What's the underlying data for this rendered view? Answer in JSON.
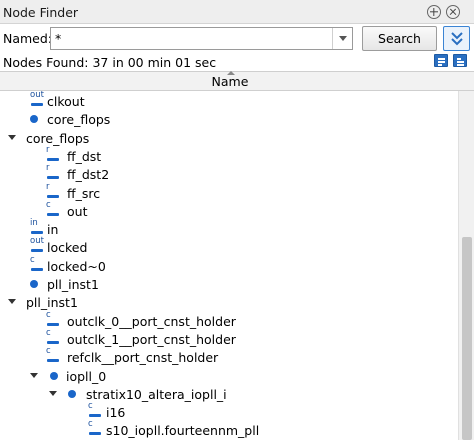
{
  "window": {
    "title": "Node Finder"
  },
  "filter": {
    "named_label": "Named:",
    "named_value": "*",
    "search_label": "Search"
  },
  "status": {
    "nodes_found": "Nodes Found: 37 in 00 min 01 sec"
  },
  "table": {
    "column_name": "Name"
  },
  "icons": {
    "add": "add-icon",
    "close": "close-icon",
    "collapse": "double-chevron-down-icon",
    "expand_all": "expand-all-icon",
    "collapse_all": "collapse-all-icon"
  },
  "colors": {
    "node_dot": "#1a66c9",
    "accent": "#3b84d4"
  },
  "tree": [
    {
      "label": "clkout",
      "kind": "port",
      "tag": "out",
      "depth": 0
    },
    {
      "label": "core_flops",
      "kind": "dot",
      "depth": 0
    },
    {
      "label": "core_flops",
      "kind": "expanded",
      "depth": -1
    },
    {
      "label": "ff_dst",
      "kind": "port",
      "tag": "r",
      "depth": 1
    },
    {
      "label": "ff_dst2",
      "kind": "port",
      "tag": "r",
      "depth": 1
    },
    {
      "label": "ff_src",
      "kind": "port",
      "tag": "r",
      "depth": 1
    },
    {
      "label": "out",
      "kind": "port",
      "tag": "c",
      "depth": 1
    },
    {
      "label": "in",
      "kind": "port",
      "tag": "in",
      "depth": 0
    },
    {
      "label": "locked",
      "kind": "port",
      "tag": "out",
      "depth": 0
    },
    {
      "label": "locked~0",
      "kind": "port",
      "tag": "c",
      "depth": 0
    },
    {
      "label": "pll_inst1",
      "kind": "dot",
      "depth": 0
    },
    {
      "label": "pll_inst1",
      "kind": "expanded",
      "depth": -1
    },
    {
      "label": "outclk_0__port_cnst_holder",
      "kind": "port",
      "tag": "c",
      "depth": 1
    },
    {
      "label": "outclk_1__port_cnst_holder",
      "kind": "port",
      "tag": "c",
      "depth": 1
    },
    {
      "label": "refclk__port_cnst_holder",
      "kind": "port",
      "tag": "c",
      "depth": 1
    },
    {
      "label": "iopll_0",
      "kind": "expanded-dot",
      "depth": 1
    },
    {
      "label": "stratix10_altera_iopll_i",
      "kind": "expanded-dot",
      "depth": 2
    },
    {
      "label": "i16",
      "kind": "port",
      "tag": "c",
      "depth": 3
    },
    {
      "label": "s10_iopll.fourteennm_pll",
      "kind": "port",
      "tag": "c",
      "depth": 3
    }
  ]
}
